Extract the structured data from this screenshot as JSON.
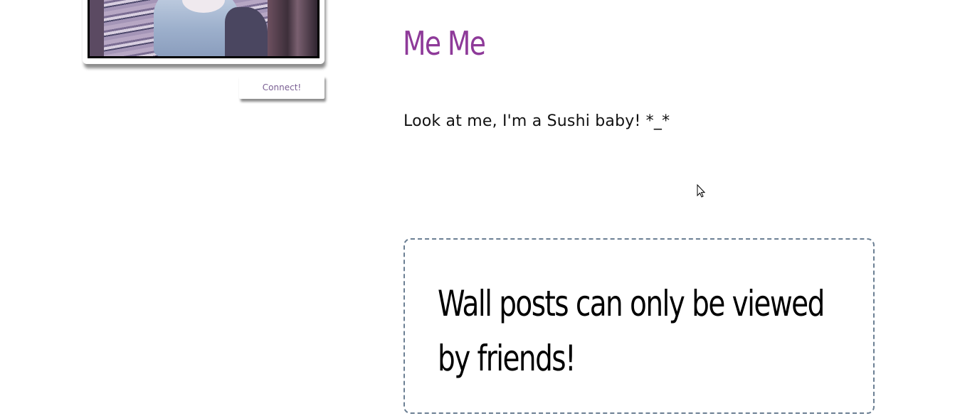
{
  "profile": {
    "name": "Me Me",
    "bio": "Look at me, I'm a Sushi baby! *_*",
    "connect_label": "Connect!"
  },
  "wall": {
    "notice": "Wall posts can only be viewed by friends!"
  },
  "colors": {
    "name": "#8e3a99",
    "connect_text": "#7a5f93",
    "wall_border": "#6b7f93"
  },
  "icons": {
    "cursor": "mouse-pointer-icon"
  }
}
